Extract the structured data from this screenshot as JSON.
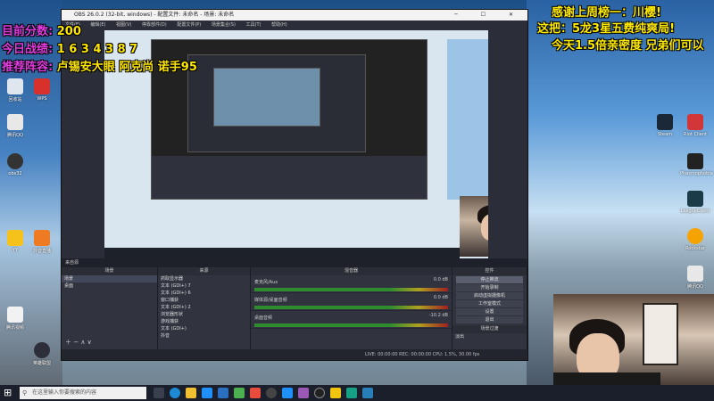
{
  "overlay_left": {
    "score_label": "目前分数:",
    "score_value": "200",
    "record_label": "今日战绩:",
    "record_value": "1 6 3 4 3 8 7",
    "recommend_label": "推荐阵容:",
    "recommend_value": "卢锡安大眼 阿克尚 诺手95"
  },
  "overlay_right": {
    "line1": "感谢上周榜一：川樱!",
    "line2": "这把：5龙3星五费纯爽局!",
    "line3": "今天1.5倍亲密度 兄弟们可以"
  },
  "obs": {
    "title": "OBS 26.0.2 (32-bit, windows) - 配置文件: 未命名 - 场景: 未命名",
    "menu": [
      "文件(F)",
      "编辑(E)",
      "视图(V)",
      "停靠部件(D)",
      "配置文件(P)",
      "场景集合(S)",
      "工具(T)",
      "帮助(H)"
    ],
    "panel_bar_label": "来自源",
    "scenes_header": "场景",
    "scenes": [
      "场景",
      "桌面"
    ],
    "sources_header": "来源",
    "sources": [
      "抓取显示器",
      "文本 (GDI+) 7",
      "文本 (GDI+) 6",
      "窗口捕获",
      "文本 (GDI+) 2",
      "浏览器形状",
      "游戏捕获",
      "文本 (GDI+)",
      "抖音",
      "视频源"
    ],
    "mixer_header": "混音器",
    "mixer": [
      {
        "label": "麦克风/Aux",
        "db": "0.0 dB"
      },
      {
        "label": "媒体源/桌面音频",
        "db": "0.0 dB"
      },
      {
        "label": "桌面音频",
        "db": "-10.2 dB"
      }
    ],
    "controls_header": "控件",
    "controls": [
      "停止推流",
      "开始录制",
      "启动虚拟摄像机",
      "工作室模式",
      "设置",
      "退出"
    ],
    "transition_header": "场景过渡",
    "transition_value": "淡出",
    "duration_label": "时长",
    "duration_value": "300 ms",
    "status": "LIVE: 00:00:00   REC: 00:00:00   CPU: 1.5%, 30.00 fps"
  },
  "taskbar": {
    "search_placeholder": "在这里输入你要搜索的内容"
  },
  "desktop_left_icons": [
    "回收站",
    "WPS",
    "腾讯QQ",
    "obs32",
    "YY",
    "抖音直播",
    "腾讯视频",
    "英雄联盟"
  ],
  "desktop_right_icons": [
    "Steam",
    "Riot Client",
    "Phasmophobia",
    "LeagueClient",
    "Rockstar",
    "腾讯QQ"
  ]
}
